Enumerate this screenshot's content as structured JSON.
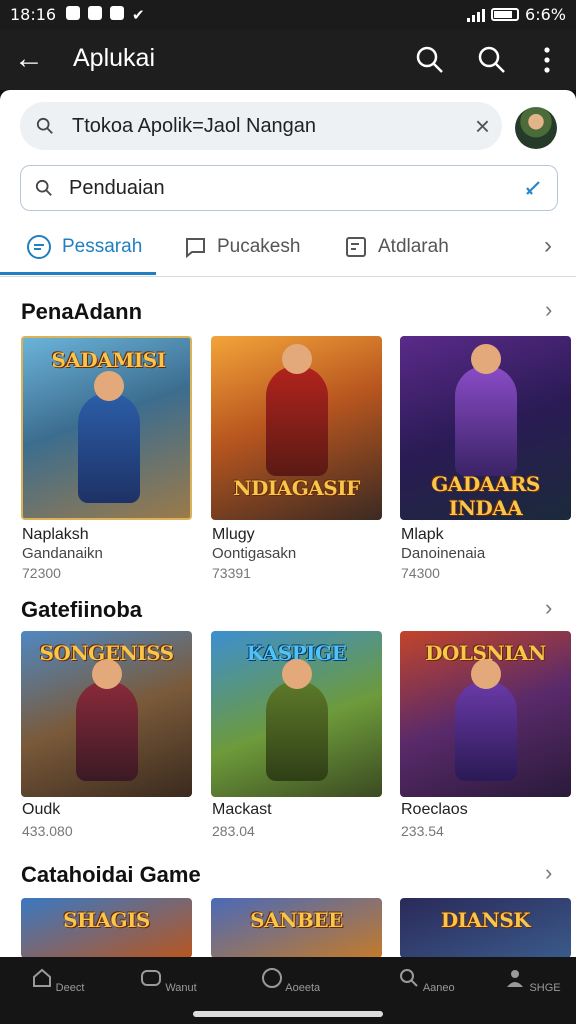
{
  "status_bar": {
    "time": "18:16",
    "battery": "6:6%"
  },
  "app_bar": {
    "title": "Aplukai"
  },
  "search_top": {
    "text": "Ttokoa Apolik=Jaol Nangan"
  },
  "search_box": {
    "text": "Penduaian"
  },
  "tabs": [
    {
      "label": "Pessarah",
      "active": true
    },
    {
      "label": "Pucakesh",
      "active": false
    },
    {
      "label": "Atdlarah",
      "active": false
    }
  ],
  "sections": [
    {
      "title": "PenaAdann",
      "cards": [
        {
          "banner": "SADAMISI",
          "name": "Naplaksh",
          "sub": "Gandanaikn",
          "rating": "72300"
        },
        {
          "banner": "NDIAGASIF",
          "name": "Mlugy",
          "sub": "Oontigasakn",
          "rating": "73391"
        },
        {
          "banner": "GADAARS INDAA",
          "name": "Mlapk",
          "sub": "Danoinenaia",
          "rating": "74300"
        }
      ]
    },
    {
      "title": "Gatefiinoba",
      "cards": [
        {
          "banner": "SONGENISS",
          "name": "Oudk",
          "sub": "",
          "rating": "433.080"
        },
        {
          "banner": "KASPIGE",
          "name": "Mackast",
          "sub": "",
          "rating": "283.04"
        },
        {
          "banner": "DOLSNIAN",
          "name": "Roeclaos",
          "sub": "",
          "rating": "233.54"
        }
      ]
    },
    {
      "title": "Catahoidai Game",
      "cards": [
        {
          "banner": "SHAGIS",
          "name": "",
          "sub": "",
          "rating": ""
        },
        {
          "banner": "SANBEE",
          "name": "",
          "sub": "",
          "rating": ""
        },
        {
          "banner": "DIANSK",
          "name": "",
          "sub": "",
          "rating": ""
        }
      ]
    }
  ],
  "bottom_nav": [
    {
      "label": "Deect",
      "icon": "home-icon"
    },
    {
      "label": "Wanut",
      "icon": "games-icon"
    },
    {
      "label": "Aoeeta",
      "icon": "circle-icon"
    },
    {
      "label": "Aaneo",
      "icon": "search-icon"
    },
    {
      "label": "SHGE",
      "icon": "person-icon"
    }
  ],
  "colors": {
    "accent": "#1f7fc0",
    "app_bar": "#1e1e1e"
  }
}
